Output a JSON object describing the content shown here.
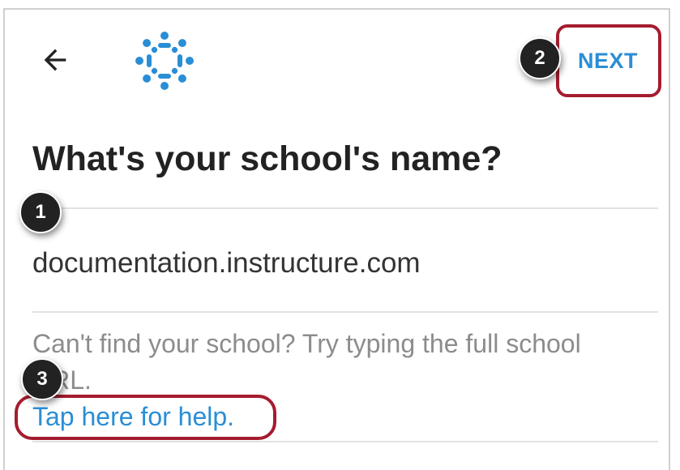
{
  "header": {
    "back_icon": "arrow-left-icon",
    "logo_icon": "canvas-logo-icon",
    "next_label": "NEXT",
    "accent_color": "#2a8ed6"
  },
  "form": {
    "title": "What's your school's name?",
    "school_value": "documentation.instructure.com",
    "hint": "Can't find your school? Try typing the full school URL.",
    "help_link": "Tap here for help."
  },
  "annotations": {
    "callouts": [
      "1",
      "2",
      "3"
    ],
    "highlight_color": "#a51c2e"
  }
}
